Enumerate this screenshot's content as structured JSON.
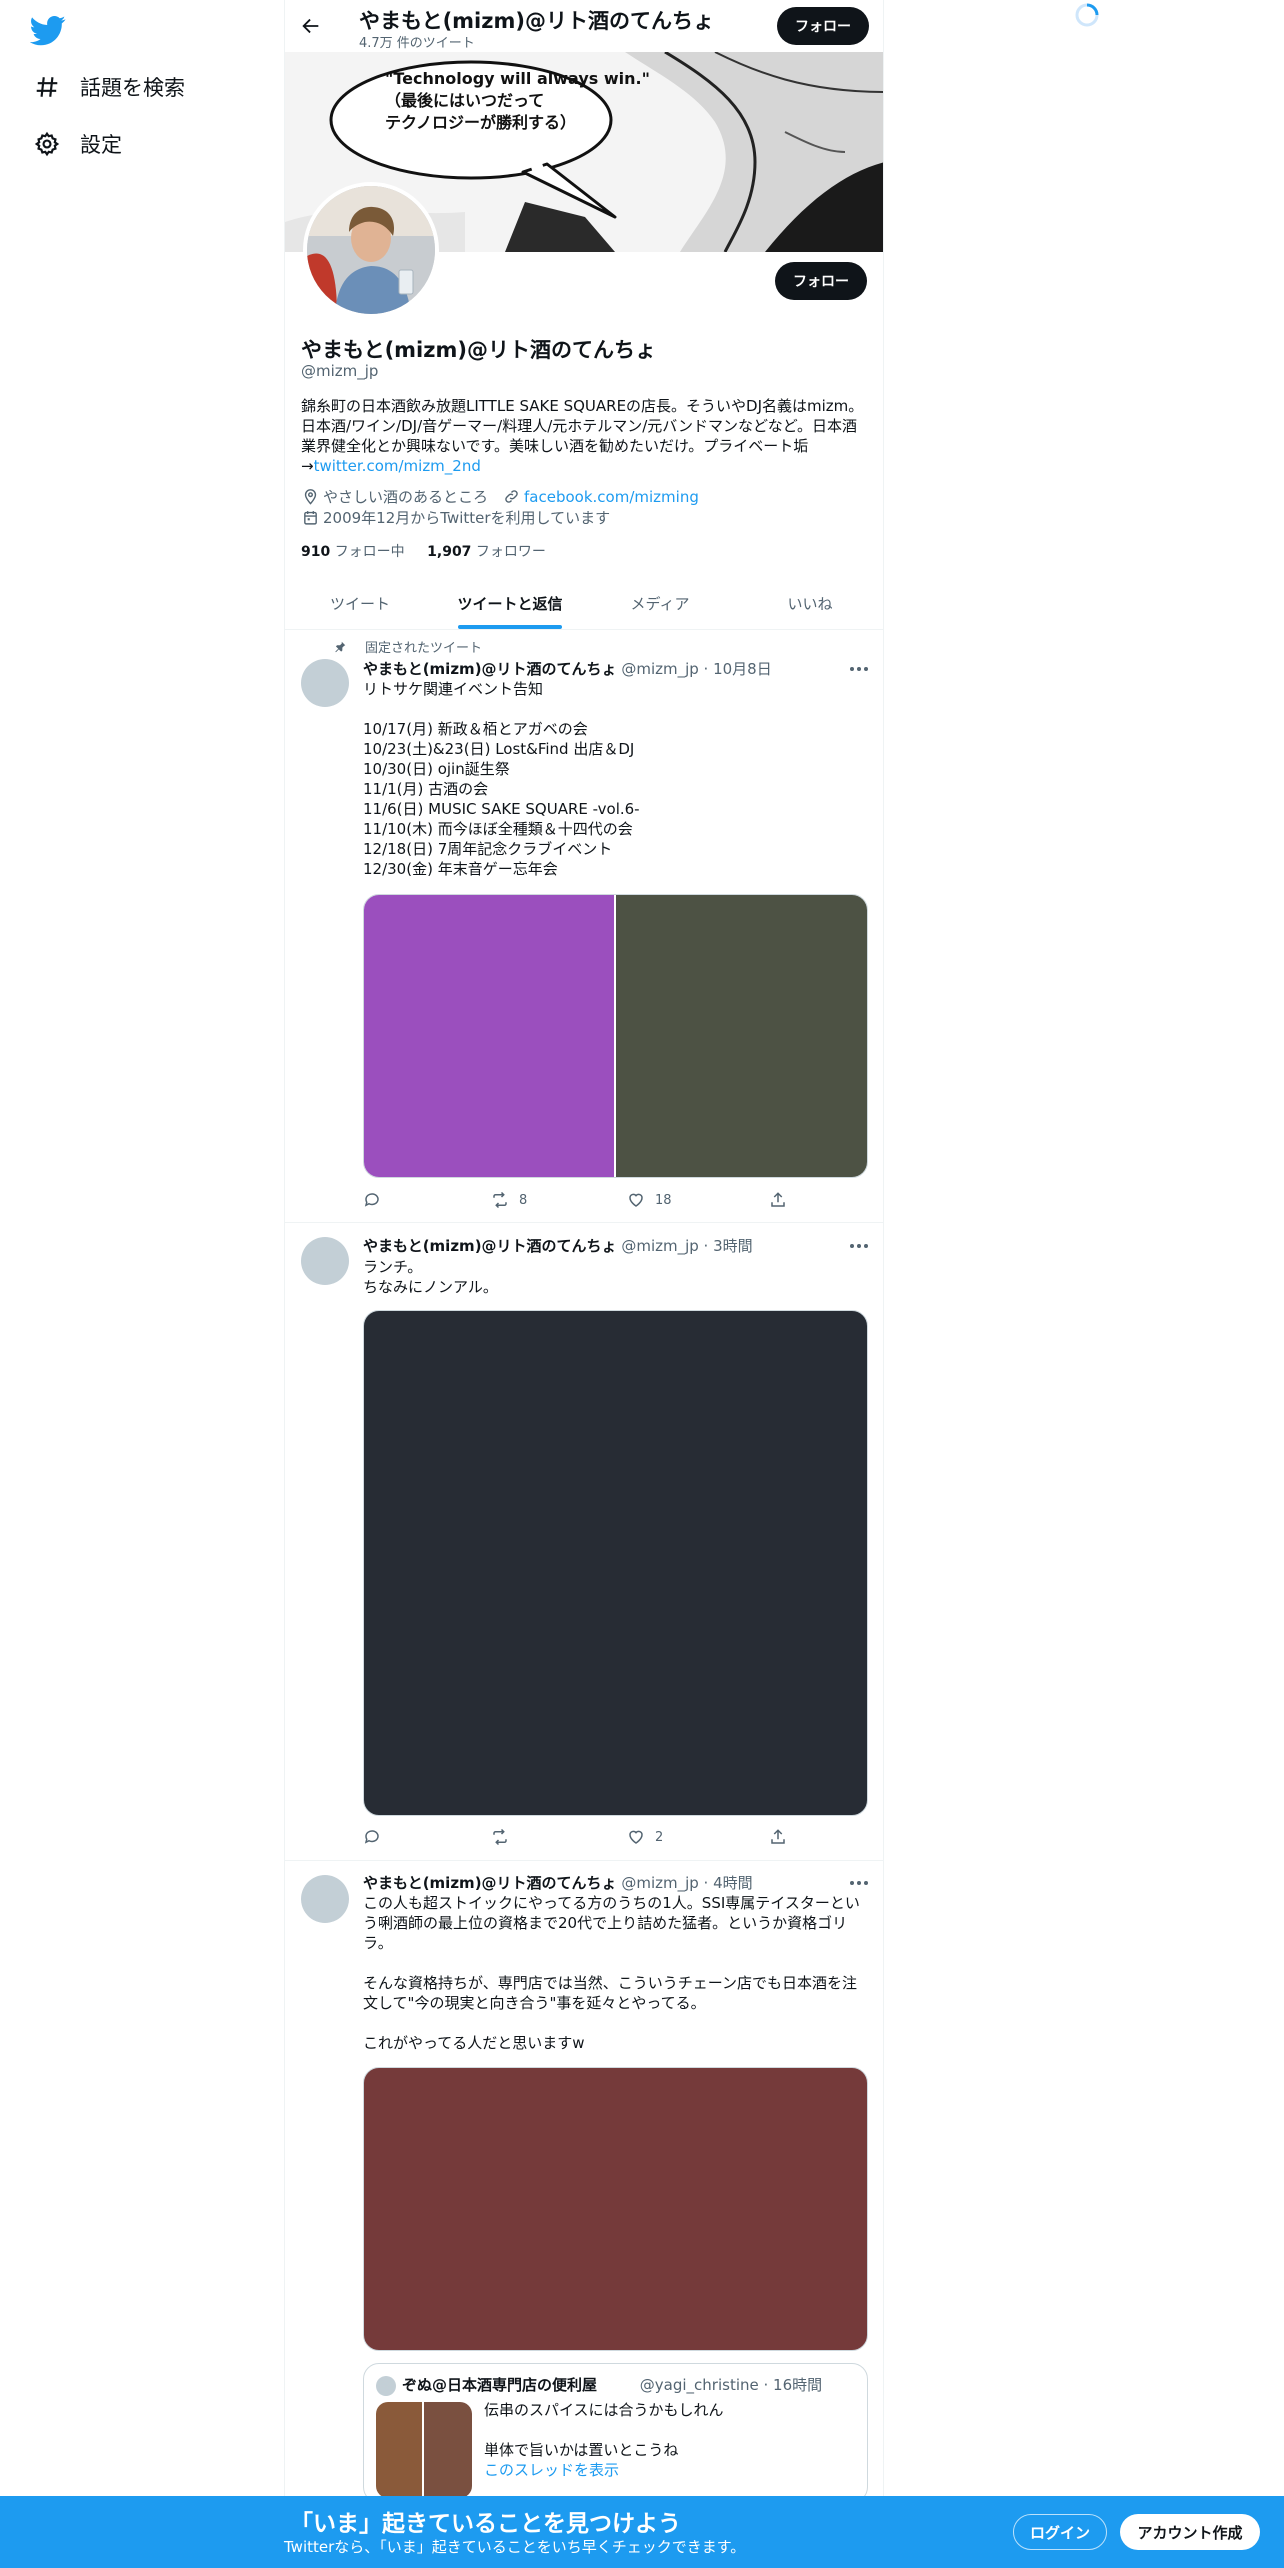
{
  "nav": {
    "logo": "twitter-bird-icon",
    "items": [
      {
        "label": "話題を検索",
        "icon": "hashtag-icon"
      },
      {
        "label": "設定",
        "icon": "gear-icon"
      }
    ]
  },
  "header": {
    "title": "やまもと(mizm)@リト酒のてんちょ",
    "subtitle": "4.7万 件のツイート",
    "follow_label": "フォロー"
  },
  "banner": {
    "quote_en": "\"Technology will always win.\"",
    "quote_jp_1": "（最後にはいつだって",
    "quote_jp_2": "テクノロジーが勝利する）"
  },
  "profile": {
    "name": "やまもと(mizm)@リト酒のてんちょ",
    "handle": "@mizm_jp",
    "follow_label": "フォロー",
    "bio_lines": [
      "錦糸町の日本酒飲み放題LITTLE SAKE SQUAREの店長。そういやDJ名義はmizm。",
      "日本酒/ワイン/DJ/音ゲーマー/料理人/元ホテルマン/元バンドマンなどなど。日本酒",
      "業界健全化とか興味ないです。美味しい酒を勧めたいだけ。プライベート垢"
    ],
    "bio_arrow": "→",
    "bio_link": "twitter.com/mizm_2nd",
    "location": "やさしい酒のあるところ",
    "website": "facebook.com/mizming",
    "joined": "2009年12月からTwitterを利用しています",
    "following_count": "910",
    "following_label": "フォロー中",
    "followers_count": "1,907",
    "followers_label": "フォロワー"
  },
  "tabs": [
    {
      "label": "ツイート",
      "active": false
    },
    {
      "label": "ツイートと返信",
      "active": true
    },
    {
      "label": "メディア",
      "active": false
    },
    {
      "label": "いいね",
      "active": false
    }
  ],
  "tweets": [
    {
      "pinned_label": "固定されたツイート",
      "name": "やまもと(mizm)@リト酒のてんちょ",
      "handle_time": "@mizm_jp · 10月8日",
      "lines": [
        "リトサケ関連イベント告知",
        "",
        "10/17(月) 新政＆栢とアガベの会",
        "10/23(土)&23(日) Lost&Find 出店＆DJ",
        "10/30(日) ojin誕生祭",
        "11/1(月) 古酒の会",
        "11/6(日) MUSIC SAKE SQUARE -vol.6-",
        "11/10(木) 而今ほぼ全種類＆十四代の会",
        "12/18(日) 7周年記念クラブイベント",
        "12/30(金) 年末音ゲー忘年会"
      ],
      "retweets": "8",
      "likes": "18",
      "media_colors": [
        "#9b4fbe",
        "#4d5244"
      ]
    },
    {
      "name": "やまもと(mizm)@リト酒のてんちょ",
      "handle_time": "@mizm_jp · 3時間",
      "lines": [
        "ランチ。",
        "ちなみにノンアル。"
      ],
      "retweets": "",
      "likes": "2",
      "media_colors": [
        "#272c34"
      ]
    },
    {
      "name": "やまもと(mizm)@リト酒のてんちょ",
      "handle_time": "@mizm_jp · 4時間",
      "lines": [
        "この人も超ストイックにやってる方のうちの1人。SSI専属テイスターとい",
        "う唎酒師の最上位の資格まで20代で上り詰めた猛者。というか資格ゴリ",
        "ラ。",
        "",
        "そんな資格持ちが、専門店では当然、こういうチェーン店でも日本酒を注",
        "文して\"今の現実と向き合う\"事を延々とやってる。",
        "",
        "これがやってる人だと思いますw"
      ],
      "media_colors": [
        "#753a3a"
      ],
      "quote": {
        "name": "ぞぬ@日本酒専門店の便利屋",
        "handle_time": "@yagi_christine · 16時間",
        "line1": "伝串のスパイスには合うかもしれん",
        "line2": "単体で旨いかは置いとこうね",
        "thread_link": "このスレッドを表示",
        "thumb_colors": [
          "#8a5a3a",
          "#7a5040"
        ]
      }
    }
  ],
  "bottom_bar": {
    "title": "「いま」起きていることを見つけよう",
    "subtitle": "Twitterなら、「いま」起きていることをいち早くチェックできます。",
    "login_label": "ログイン",
    "signup_label": "アカウント作成"
  },
  "colors": {
    "accent": "#1d9bf0",
    "text": "#0f1419",
    "secondary": "#536471"
  }
}
